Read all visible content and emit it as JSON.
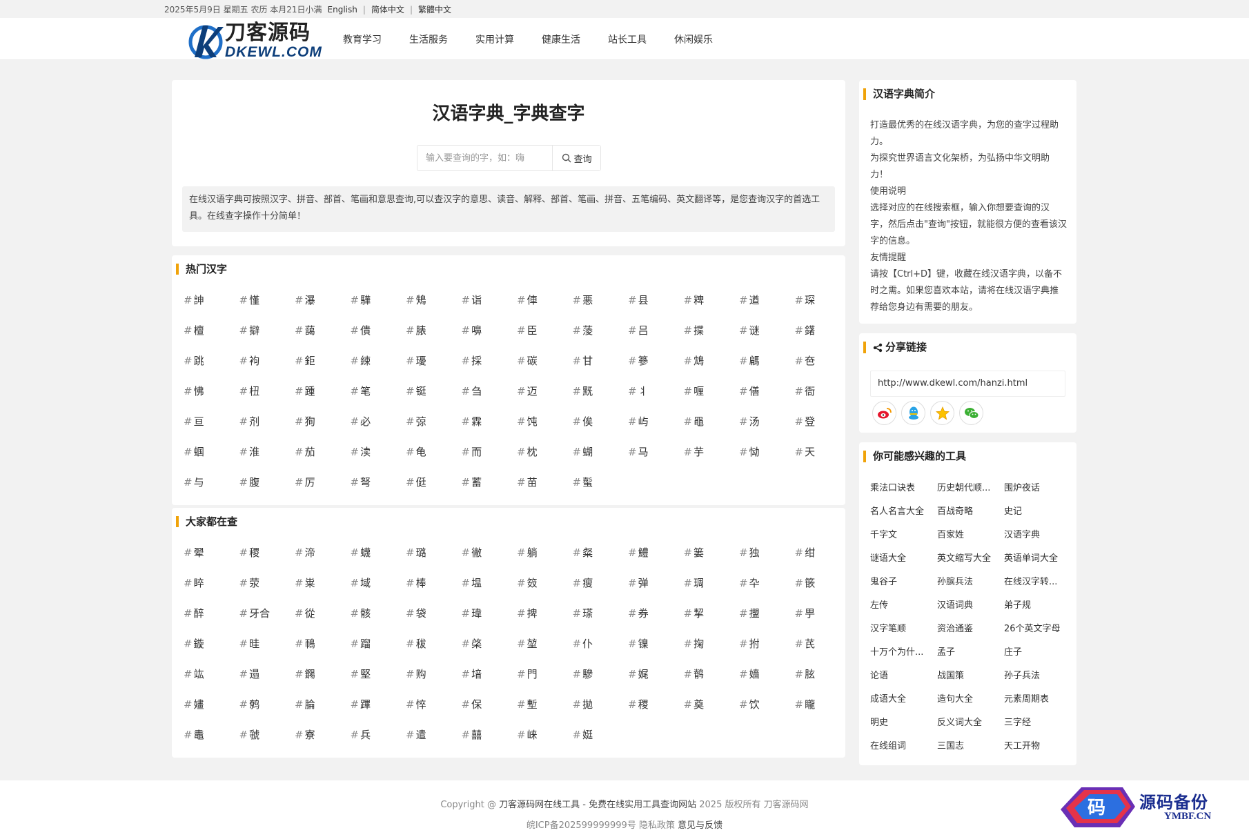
{
  "topbar": {
    "date": "2025年5月9日 星期五 农历 本月21日小满",
    "lang_en": "English",
    "lang_sc": "简体中文",
    "lang_tc": "繁體中文",
    "sep": "|"
  },
  "header": {
    "logo_cn": "刀客源码",
    "logo_en": "DKEWL.COM",
    "nav": [
      "教育学习",
      "生活服务",
      "实用计算",
      "健康生活",
      "站长工具",
      "休闲娱乐"
    ]
  },
  "main": {
    "title": "汉语字典_字典查字",
    "search_placeholder": "输入要查询的字，如：嗨",
    "search_button": "查询",
    "description": "在线汉语字典可按照汉字、拼音、部首、笔画和意思查询,可以查汉字的意思、读音、解释、部首、笔画、拼音、五笔编码、英文翻译等，是您查询汉字的首选工具。在线查字操作十分简单！"
  },
  "hot": {
    "title": "热门汉字",
    "hash": "#",
    "items": [
      "訷",
      "慬",
      "瀑",
      "驊",
      "鴩",
      "诣",
      "俥",
      "悪",
      "县",
      "粺",
      "遒",
      "琛",
      "檀",
      "擗",
      "藹",
      "僓",
      "脿",
      "嚊",
      "臣",
      "蔆",
      "吕",
      "揲",
      "谜",
      "鐯",
      "跳",
      "袧",
      "鉅",
      "綀",
      "瓇",
      "採",
      "碳",
      "甘",
      "篸",
      "鴆",
      "騗",
      "夿",
      "怫",
      "杻",
      "踵",
      "笔",
      "铤",
      "刍",
      "迈",
      "黖",
      "丬",
      "喱",
      "僐",
      "衙",
      "亘",
      "剂",
      "狥",
      "必",
      "弶",
      "霖",
      "饨",
      "俟",
      "屿",
      "黽",
      "汤",
      "登",
      "蝈",
      "淮",
      "茄",
      "渎",
      "龟",
      "而",
      "枕",
      "蝴",
      "马",
      "芋",
      "恸",
      "天",
      "与",
      "腹",
      "厉",
      "弩",
      "侹",
      "蓄",
      "苗",
      "蟚"
    ]
  },
  "popular": {
    "title": "大家都在查",
    "hash": "#",
    "items": [
      "翚",
      "稷",
      "渧",
      "蠛",
      "璐",
      "徶",
      "躺",
      "粲",
      "鱧",
      "篓",
      "独",
      "绀",
      "睟",
      "荥",
      "粜",
      "域",
      "棒",
      "塭",
      "笯",
      "瘦",
      "弹",
      "琱",
      "卆",
      "篏",
      "醉",
      "牙合",
      "從",
      "骸",
      "袋",
      "瑋",
      "捭",
      "瑹",
      "券",
      "挈",
      "擝",
      "甼",
      "鏇",
      "晆",
      "鳾",
      "蹓",
      "秡",
      "棨",
      "堃",
      "仆",
      "镍",
      "掬",
      "拊",
      "芪",
      "竑",
      "遢",
      "鐊",
      "堅",
      "购",
      "堷",
      "門",
      "驂",
      "娓",
      "鹡",
      "嫱",
      "胘",
      "嫿",
      "鹩",
      "腀",
      "蹕",
      "悴",
      "保",
      "塹",
      "拋",
      "稷",
      "奠",
      "饮",
      "矓",
      "鼃",
      "虢",
      "寮",
      "兵",
      "遣",
      "囍",
      "崃",
      "娗"
    ]
  },
  "intro": {
    "title": "汉语字典简介",
    "paragraphs": [
      "打造最优秀的在线汉语字典，为您的查字过程助力。",
      "为探究世界语言文化架桥，为弘扬中华文明助力！",
      "使用说明",
      "选择对应的在线搜索框，输入你想要查询的汉字，然后点击\"查询\"按钮，就能很方便的查看该汉字的信息。",
      "友情提醒",
      "请按【Ctrl+D】键，收藏在线汉语字典，以备不时之需。如果您喜欢本站，请将在线汉语字典推荐给您身边有需要的朋友。"
    ]
  },
  "share": {
    "title": "分享链接",
    "url": "http://www.dkewl.com/hanzi.html",
    "icons": [
      "weibo-icon",
      "qq-icon",
      "qzone-icon",
      "wechat-icon"
    ]
  },
  "tools": {
    "title": "你可能感兴趣的工具",
    "items": [
      "乘法口诀表",
      "历史朝代顺...",
      "围炉夜话",
      "名人名言大全",
      "百战奇略",
      "史记",
      "千字文",
      "百家姓",
      "汉语字典",
      "谜语大全",
      "英文缩写大全",
      "英语单词大全",
      "鬼谷子",
      "孙膑兵法",
      "在线汉字转...",
      "左传",
      "汉语词典",
      "弟子规",
      "汉字笔顺",
      "资治通鉴",
      "26个英文字母",
      "十万个为什...",
      "孟子",
      "庄子",
      "论语",
      "战国策",
      "孙子兵法",
      "成语大全",
      "造句大全",
      "元素周期表",
      "明史",
      "反义词大全",
      "三字经",
      "在线组词",
      "三国志",
      "天工开物"
    ]
  },
  "footer": {
    "copyright_prefix": "Copyright @",
    "site_link": "刀客源码网在线工具 - 免费在线实用工具查询网站",
    "rights": "2025 版权所有 刀客源码网",
    "icp": "皖ICP备202599999999号",
    "privacy": "隐私政策",
    "feedback": "意见与反馈"
  },
  "watermark": {
    "text": "源码备份",
    "sub": "YMBF.CN",
    "badge": "码"
  },
  "colors": {
    "accent": "#f0a30a",
    "logo_blue": "#0d3e7a"
  }
}
